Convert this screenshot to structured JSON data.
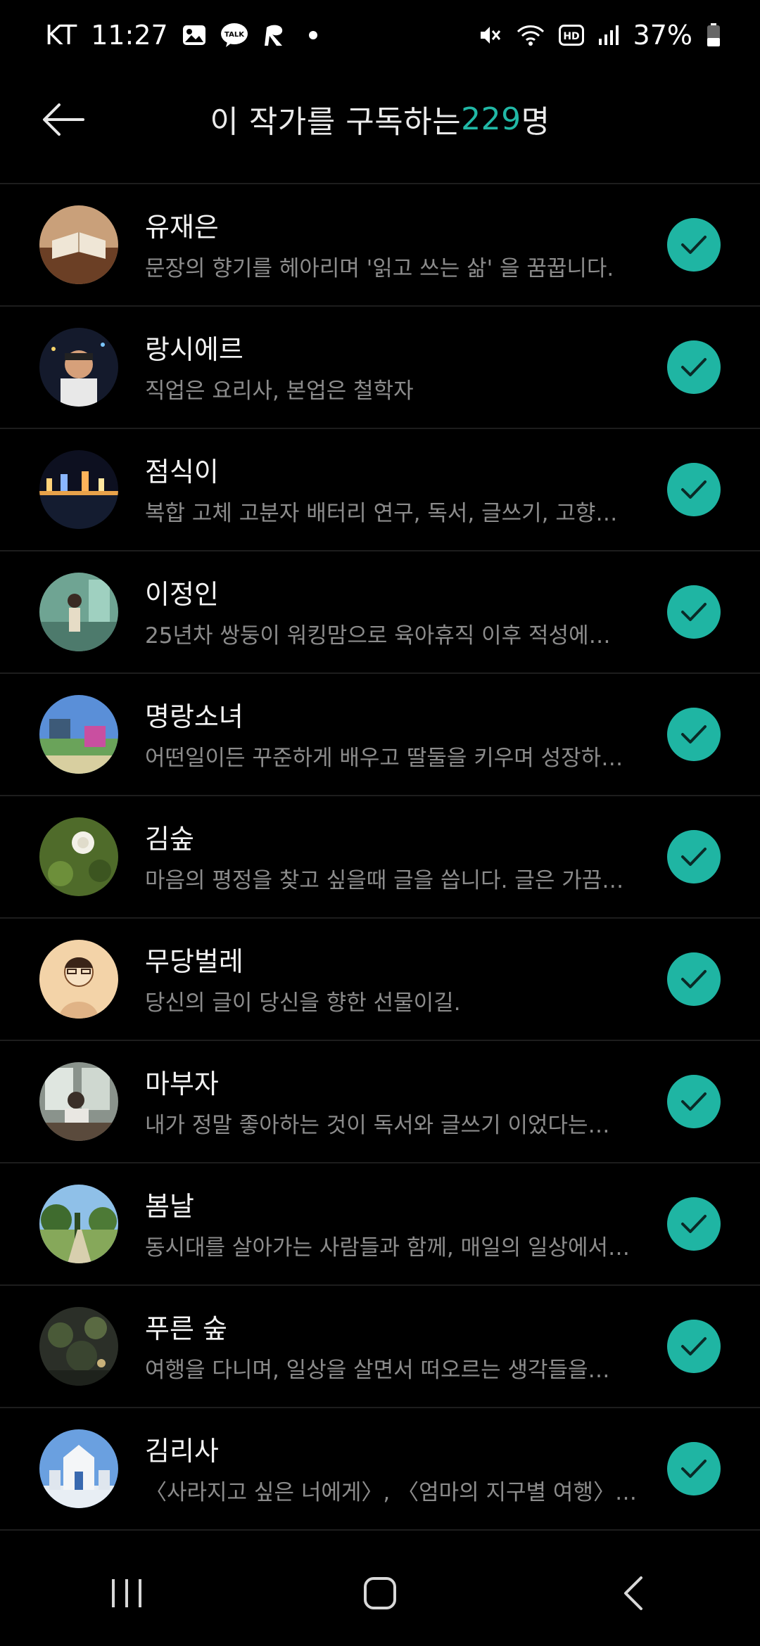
{
  "status_bar": {
    "carrier": "KT",
    "time": "11:27",
    "battery": "37%",
    "talk_label": "TALK",
    "hd_label": "HD",
    "left_icons": [
      "gallery-icon",
      "kakaotalk-icon",
      "app-r-icon",
      "dot-icon"
    ],
    "right_icons": [
      "mute-icon",
      "wifi-icon",
      "hd-icon",
      "signal-icon",
      "battery-icon"
    ]
  },
  "header": {
    "title_prefix": "이 작가를 구독하는 ",
    "count": "229",
    "title_suffix": "명"
  },
  "colors": {
    "accent": "#1fb5a3",
    "background": "#000000",
    "name_text": "#f2f2f2",
    "desc_text": "#8c8c8c"
  },
  "subscribers": [
    {
      "name": "유재은",
      "desc": "문장의 향기를 헤아리며 '읽고 쓰는 삶' 을 꿈꿉니다."
    },
    {
      "name": "랑시에르",
      "desc": "직업은 요리사, 본업은 철학자"
    },
    {
      "name": "점식이",
      "desc": "복합 고체 고분자 배터리 연구, 독서, 글쓰기, 고향…"
    },
    {
      "name": "이정인",
      "desc": "25년차 쌍둥이 워킹맘으로 육아휴직 이후 적성에…"
    },
    {
      "name": "명랑소녀",
      "desc": "어떤일이든 꾸준하게 배우고 딸둘을 키우며 성장하…"
    },
    {
      "name": "김숲",
      "desc": "마음의 평정을 찾고 싶을때 글을 씁니다. 글은 가끔…"
    },
    {
      "name": "무당벌레",
      "desc": "당신의 글이 당신을 향한 선물이길."
    },
    {
      "name": "마부자",
      "desc": "내가 정말 좋아하는 것이 독서와 글쓰기 이었다는…"
    },
    {
      "name": "봄날",
      "desc": "동시대를 살아가는 사람들과 함께, 매일의 일상에서…"
    },
    {
      "name": "푸른 숲",
      "desc": "여행을 다니며, 일상을 살면서 떠오르는 생각들을…"
    },
    {
      "name": "김리사",
      "desc": "〈사라지고 싶은 너에게〉, 〈엄마의 지구별 여행〉 저…"
    }
  ],
  "nav": {
    "icons": [
      "recent-apps-icon",
      "home-icon",
      "back-nav-icon"
    ]
  }
}
